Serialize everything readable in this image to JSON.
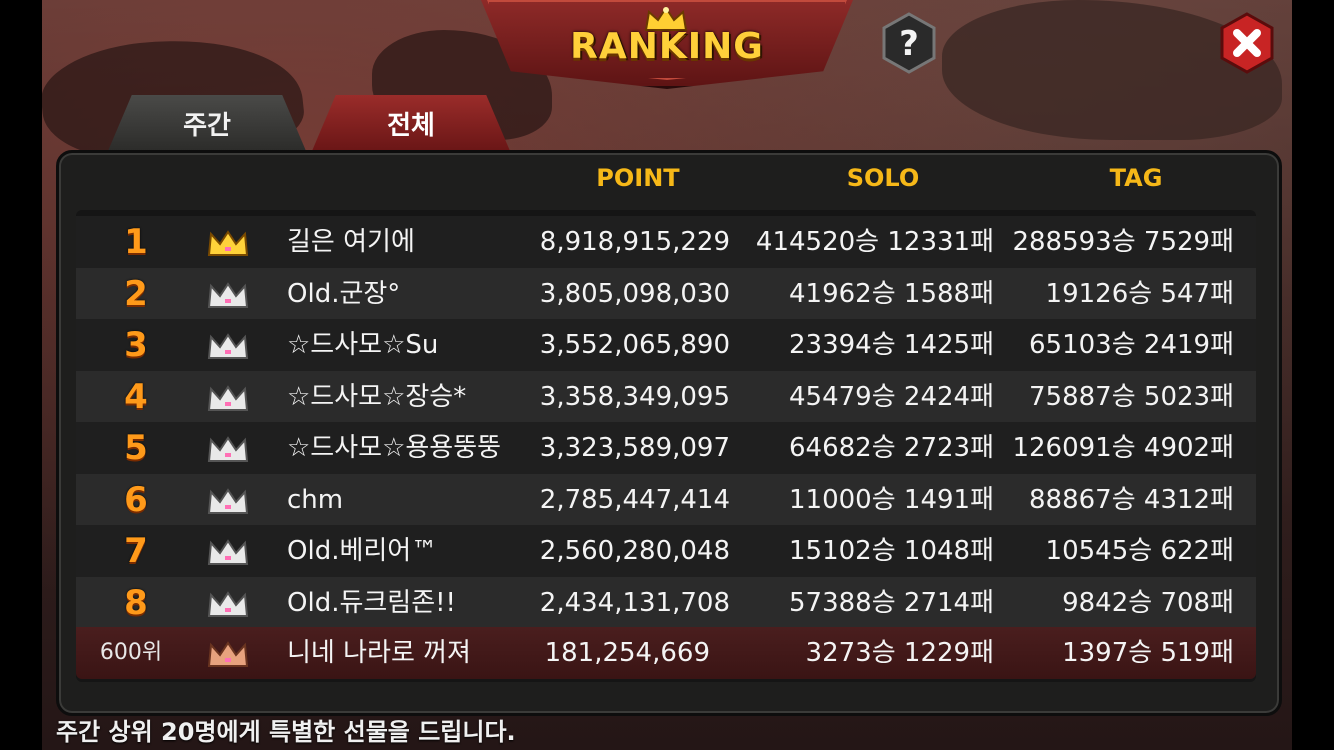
{
  "title": "RANKING",
  "tabs": {
    "weekly": "주간",
    "all": "전체"
  },
  "headers": {
    "point": "POINT",
    "solo": "SOLO",
    "tag": "TAG"
  },
  "rows": [
    {
      "rank": "1",
      "crown": "gold",
      "name": "길은 여기에",
      "point": "8,918,915,229",
      "solo": "414520승 12331패",
      "tag": "288593승 7529패"
    },
    {
      "rank": "2",
      "crown": "silver",
      "name": "Old.군장°",
      "point": "3,805,098,030",
      "solo": "41962승 1588패",
      "tag": "19126승 547패"
    },
    {
      "rank": "3",
      "crown": "silver",
      "name": "☆드사모☆Su",
      "point": "3,552,065,890",
      "solo": "23394승 1425패",
      "tag": "65103승 2419패"
    },
    {
      "rank": "4",
      "crown": "silver",
      "name": "☆드사모☆장승*",
      "point": "3,358,349,095",
      "solo": "45479승 2424패",
      "tag": "75887승 5023패"
    },
    {
      "rank": "5",
      "crown": "silver",
      "name": "☆드사모☆용용뚱뚱",
      "point": "3,323,589,097",
      "solo": "64682승 2723패",
      "tag": "126091승 4902패"
    },
    {
      "rank": "6",
      "crown": "silver",
      "name": "chm",
      "point": "2,785,447,414",
      "solo": "11000승 1491패",
      "tag": "88867승 4312패"
    },
    {
      "rank": "7",
      "crown": "silver",
      "name": "Old.베리어™",
      "point": "2,560,280,048",
      "solo": "15102승 1048패",
      "tag": "10545승 622패"
    },
    {
      "rank": "8",
      "crown": "silver",
      "name": "Old.듀크림존!!",
      "point": "2,434,131,708",
      "solo": "57388승 2714패",
      "tag": "9842승 708패"
    }
  ],
  "my_row": {
    "rank": "600위",
    "crown": "bronze",
    "name": "니네 나라로 꺼져",
    "point": "181,254,669",
    "solo": "3273승 1229패",
    "tag": "1397승 519패"
  },
  "footer": "주간 상위 20명에게 특별한 선물을 드립니다.",
  "colors": {
    "accent": "#f6b818",
    "rank": "#ff9a1a",
    "tab_active": "#8e2a28",
    "panel": "#1e1e1d"
  },
  "icons": {
    "help": "question-icon",
    "close": "close-icon",
    "crown": "crown-icon"
  }
}
